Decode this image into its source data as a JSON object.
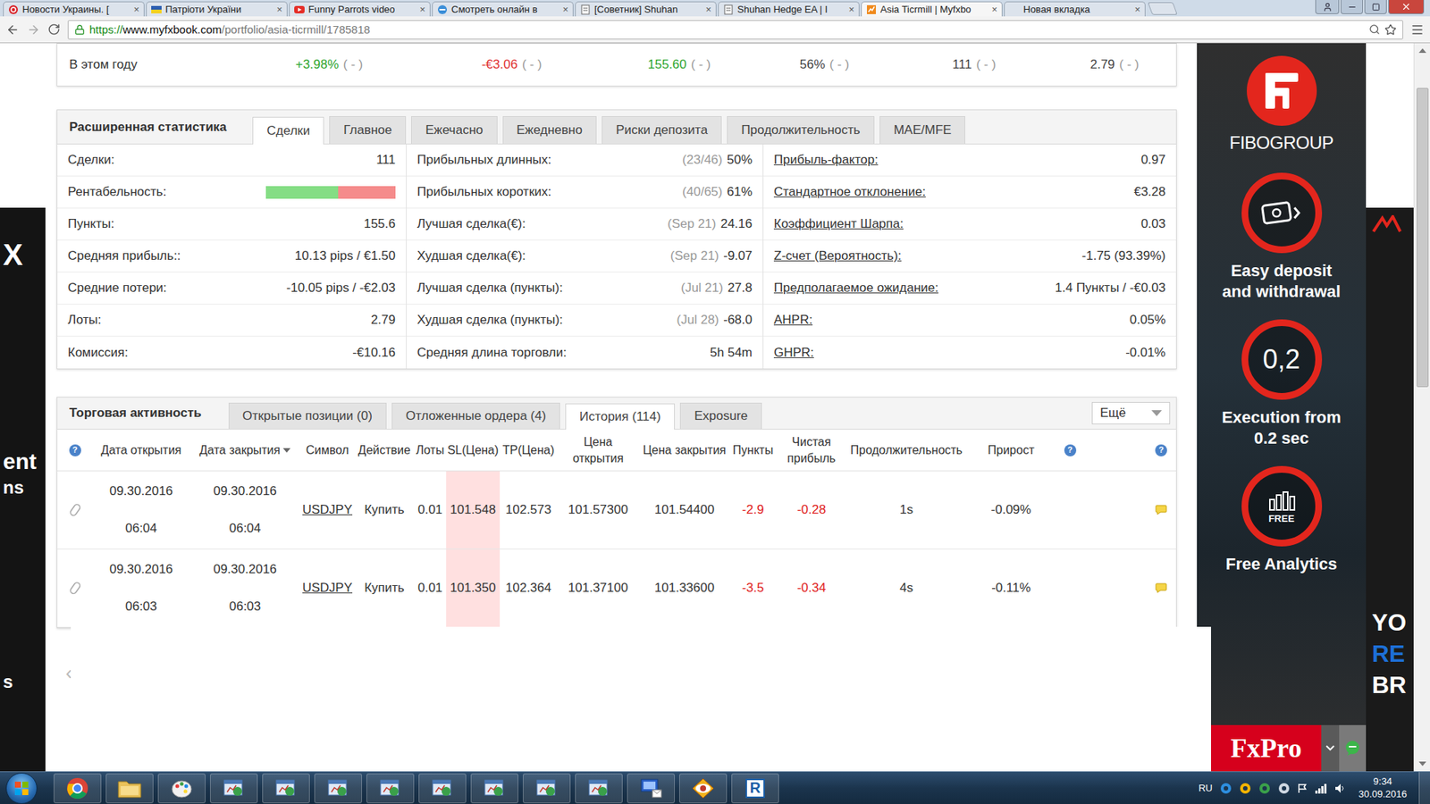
{
  "browser": {
    "tabs": [
      {
        "label": "Новости Украины. [",
        "selected": false,
        "kind": "news"
      },
      {
        "label": "Патріоти України",
        "selected": false,
        "kind": "flag"
      },
      {
        "label": "Funny Parrots video",
        "selected": false,
        "kind": "video"
      },
      {
        "label": "Смотреть онлайн в",
        "selected": false,
        "kind": "web"
      },
      {
        "label": "[Советник] Shuhan",
        "selected": false,
        "kind": "forum"
      },
      {
        "label": "Shuhan Hedge EA | I",
        "selected": false,
        "kind": "forum"
      },
      {
        "label": "Asia Ticrmill | Myfxbo",
        "selected": true,
        "kind": "fx"
      },
      {
        "label": "Новая вкладка",
        "selected": false,
        "kind": "blank"
      }
    ],
    "close_glyph": "×",
    "address": {
      "scheme": "https://",
      "host": "www.myfxbook.com",
      "path": "/portfolio/asia-ticrmill/1785818"
    }
  },
  "year_row": {
    "label": "В этом году",
    "cells": [
      {
        "value": "+3.98%",
        "note": "( - )",
        "color": "#2ea52e"
      },
      {
        "value": "-€3.06",
        "note": "( - )",
        "color": "#e03131"
      },
      {
        "value": "155.60",
        "note": "( - )",
        "color": "#2ea52e"
      },
      {
        "value": "56%",
        "note": "( - )",
        "color": "#444444"
      },
      {
        "value": "111",
        "note": "( - )",
        "color": "#444444"
      },
      {
        "value": "2.79",
        "note": "( - )",
        "color": "#444444"
      }
    ]
  },
  "stats": {
    "title": "Расширенная статистика",
    "tabs": [
      {
        "label": "Сделки",
        "selected": true
      },
      {
        "label": "Главное",
        "selected": false
      },
      {
        "label": "Ежечасно",
        "selected": false
      },
      {
        "label": "Ежедневно",
        "selected": false
      },
      {
        "label": "Риски депозита",
        "selected": false
      },
      {
        "label": "Продолжительность",
        "selected": false
      },
      {
        "label": "MAE/MFE",
        "selected": false
      }
    ],
    "columns": [
      [
        {
          "label": "Сделки:",
          "value": "111",
          "kind": "value",
          "link": false
        },
        {
          "label": "Рентабельность:",
          "kind": "bar",
          "level": 0.56,
          "link": false
        },
        {
          "label": "Пункты:",
          "value": "155.6",
          "kind": "value",
          "link": false
        },
        {
          "label": "Средняя прибыль::",
          "value": "10.13 pips / €1.50",
          "kind": "value",
          "link": false
        },
        {
          "label": "Средние потери:",
          "value": "-10.05 pips / -€2.03",
          "kind": "value",
          "link": false
        },
        {
          "label": "Лоты:",
          "value": "2.79",
          "kind": "value",
          "link": false
        },
        {
          "label": "Комиссия:",
          "value": "-€10.16",
          "kind": "value",
          "link": false
        }
      ],
      [
        {
          "label": "Прибыльных длинных:",
          "note": "(23/46)",
          "value": "50%",
          "kind": "value",
          "link": false
        },
        {
          "label": "Прибыльных коротких:",
          "note": "(40/65)",
          "value": "61%",
          "kind": "value",
          "link": false
        },
        {
          "label": "Лучшая сделка(€):",
          "note": "(Sep 21)",
          "value": "24.16",
          "kind": "value",
          "link": false
        },
        {
          "label": "Худшая сделка(€):",
          "note": "(Sep 21)",
          "value": "-9.07",
          "kind": "value",
          "link": false
        },
        {
          "label": "Лучшая сделка (пункты):",
          "note": "(Jul 21)",
          "value": "27.8",
          "kind": "value",
          "link": false
        },
        {
          "label": "Худшая сделка (пункты):",
          "note": "(Jul 28)",
          "value": "-68.0",
          "kind": "value",
          "link": false
        },
        {
          "label": "Средняя длина торговли:",
          "value": "5h 54m",
          "kind": "value",
          "link": false
        }
      ],
      [
        {
          "label": "Прибыль-фактор:",
          "value": "0.97",
          "kind": "value",
          "link": true
        },
        {
          "label": "Стандартное отклонение:",
          "value": "€3.28",
          "kind": "value",
          "link": true
        },
        {
          "label": "Коэффициент Шарпа:",
          "value": "0.03",
          "kind": "value",
          "link": true
        },
        {
          "label": "Z-счет (Вероятность):",
          "value": "-1.75 (93.39%)",
          "kind": "value",
          "link": true
        },
        {
          "label": "Предполагаемое ожидание:",
          "value": "1.4 Пункты / -€0.03",
          "kind": "value",
          "link": true
        },
        {
          "label": "AHPR:",
          "value": "0.05%",
          "kind": "value",
          "link": true
        },
        {
          "label": "GHPR:",
          "value": "-0.01%",
          "kind": "value",
          "link": true
        }
      ]
    ]
  },
  "trades": {
    "title": "Торговая активность",
    "tabs": [
      {
        "label": "Открытые позиции (0)",
        "selected": false
      },
      {
        "label": "Отложенные ордера (4)",
        "selected": false
      },
      {
        "label": "История (114)",
        "selected": true
      },
      {
        "label": "Exposure",
        "selected": false
      }
    ],
    "more": "Ещё",
    "help_glyph": "?",
    "columns": [
      {
        "label": "",
        "kind": "help",
        "sorted": false
      },
      {
        "label": "Дата открытия",
        "kind": "text",
        "sorted": false
      },
      {
        "label": "Дата закрытия",
        "kind": "text",
        "sorted": true
      },
      {
        "label": "Символ",
        "kind": "text",
        "sorted": false
      },
      {
        "label": "Действие",
        "kind": "text",
        "sorted": false
      },
      {
        "label": "Лоты",
        "kind": "text",
        "sorted": false
      },
      {
        "label": "SL(Цена)",
        "kind": "text",
        "sorted": false
      },
      {
        "label": "TP(Цена)",
        "kind": "text",
        "sorted": false
      },
      {
        "label": "Цена открытия",
        "kind": "text",
        "sorted": false
      },
      {
        "label": "Цена закрытия",
        "kind": "text",
        "sorted": false
      },
      {
        "label": "Пункты",
        "kind": "text",
        "sorted": false
      },
      {
        "label": "Чистая прибыль",
        "kind": "text",
        "sorted": false
      },
      {
        "label": "Продолжительность",
        "kind": "text",
        "sorted": false
      },
      {
        "label": "Прирост",
        "kind": "text",
        "sorted": false
      },
      {
        "label": "",
        "kind": "help",
        "sorted": false
      },
      {
        "label": "",
        "kind": "help",
        "sorted": false
      }
    ],
    "rows": [
      {
        "open_date": "09.30.2016",
        "open_time": "06:04",
        "close_date": "09.30.2016",
        "close_time": "06:04",
        "symbol": "USDJPY",
        "action": "Купить",
        "lots": "0.01",
        "sl": "101.548",
        "tp": "102.573",
        "open_price": "101.57300",
        "close_price": "101.54400",
        "points": "-2.9",
        "profit": "-0.28",
        "duration": "1s",
        "gain": "-0.09%",
        "loss": true
      },
      {
        "open_date": "09.30.2016",
        "open_time": "06:03",
        "close_date": "09.30.2016",
        "close_time": "06:03",
        "symbol": "USDJPY",
        "action": "Купить",
        "lots": "0.01",
        "sl": "101.350",
        "tp": "102.364",
        "open_price": "101.37100",
        "close_price": "101.33600",
        "points": "-3.5",
        "profit": "-0.34",
        "duration": "4s",
        "gain": "-0.11%",
        "loss": true
      }
    ]
  },
  "pager": {
    "prev": "‹"
  },
  "left_ad": {
    "texts": [
      "X",
      "ent",
      "ns",
      "s"
    ]
  },
  "right_ad": {
    "brand": "FIBOGROUP",
    "items": [
      {
        "kind": "wallet",
        "text": "Easy deposit and withdrawal"
      },
      {
        "kind": "speed",
        "badge": "0,2",
        "text": "Execution from 0.2 sec"
      },
      {
        "kind": "chart",
        "badge": "FREE",
        "text": "Free Analytics"
      }
    ],
    "footer": "FxPro"
  },
  "far_ad": {
    "texts": [
      {
        "text": "YO",
        "color": "#ffffff"
      },
      {
        "text": "RE",
        "color": "#1d6fd6"
      },
      {
        "text": "BR",
        "color": "#ffffff"
      }
    ]
  },
  "taskbar": {
    "apps": [
      {
        "kind": "chrome"
      },
      {
        "kind": "folder"
      },
      {
        "kind": "paint"
      },
      {
        "kind": "app"
      },
      {
        "kind": "app"
      },
      {
        "kind": "app"
      },
      {
        "kind": "app"
      },
      {
        "kind": "app"
      },
      {
        "kind": "app"
      },
      {
        "kind": "app"
      },
      {
        "kind": "app"
      },
      {
        "kind": "mail"
      },
      {
        "kind": "eye"
      },
      {
        "kind": "r-app",
        "glyph": "R"
      }
    ],
    "language": "RU",
    "tray": [
      "ie",
      "chrome",
      "shield",
      "network",
      "flag",
      "signal",
      "volume"
    ],
    "time": "9:34",
    "date": "30.09.2016"
  }
}
